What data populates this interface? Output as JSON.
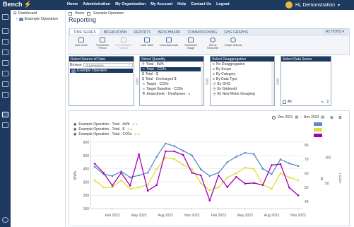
{
  "app": {
    "brand": "Bench",
    "user_greeting": "Hi, Demonstration"
  },
  "nav": [
    "Home",
    "Administration",
    "My Organisation",
    "My Account",
    "Help",
    "Contact Us",
    "Logout"
  ],
  "tree": {
    "root": "Dashboard",
    "child": "Example Operation"
  },
  "breadcrumbs": {
    "home": "Home",
    "current": "Example Operation"
  },
  "page_title": "Reporting",
  "tabs": [
    "TIME SERIES",
    "BREAKDOWN",
    "REPORTS",
    "BENCHMARK",
    "COMMISSIONING",
    "GHG GRAPHS"
  ],
  "actions_label": "ACTIONS",
  "tools": [
    {
      "label": "Add series",
      "icon": "add-series-icon",
      "enabled": true
    },
    {
      "label": "Timeseries Period",
      "icon": "calendar-icon",
      "enabled": true
    },
    {
      "label": "Normalisation Method",
      "icon": "normalise-icon",
      "enabled": false
    },
    {
      "label": "Data Table",
      "icon": "table-icon",
      "enabled": true
    },
    {
      "label": "Download Data",
      "icon": "download-icon",
      "enabled": true
    },
    {
      "label": "Download Image",
      "icon": "image-icon",
      "enabled": true
    },
    {
      "label": "Set as Favourite",
      "icon": "star-icon",
      "enabled": true
    },
    {
      "label": "Graph Options",
      "icon": "gear-icon",
      "enabled": true
    }
  ],
  "panels": {
    "source": {
      "header": "Select Source of Data",
      "browse_label": "Browse",
      "dropdown": "Organisation",
      "items": [
        "Example Operation"
      ],
      "selected": 0
    },
    "quantity": {
      "header": "Select Quantity",
      "items": [
        "Total - kWh",
        "Total - CO2e",
        "Total - $",
        "Total - Uncharged $",
        "Target - CO2e",
        "Target Baseline - CO2e",
        "Anaesthetic - Desflurane - L"
      ],
      "selected": 1
    },
    "disaggregation": {
      "header": "Select Deaggregation",
      "items": [
        "No Deaggregation",
        "By Scope",
        "By Category",
        "By Data Type",
        "By GHG",
        "By Gridmeld",
        "By New Meter Grouping"
      ],
      "selected": -1
    },
    "series": {
      "header": "Select Data Series",
      "all_label": "All"
    }
  },
  "chart_data": {
    "type": "line",
    "legend": [
      {
        "name": "Example Operation - Total - kWh",
        "color": "#5b8cc6"
      },
      {
        "name": "Example Operation - Total - $",
        "color": "#e0de3a"
      },
      {
        "name": "Example Operation - Total - CO2e",
        "color": "#a400b4"
      }
    ],
    "range": {
      "from": "Dec 2021",
      "to": "Nov 2023"
    },
    "x_ticks": [
      "Feb 2022",
      "May 2022",
      "Aug 2022",
      "Nov 2022",
      "Feb 2023",
      "May 2023",
      "Aug 2023",
      "Nov 2023"
    ],
    "x_tick_month_index": [
      2,
      5,
      8,
      11,
      14,
      17,
      20,
      23
    ],
    "left_axis": {
      "label": "MWh",
      "ticks": [
        "100",
        "200",
        "300",
        "400",
        "500",
        "600"
      ],
      "lim": [
        100,
        600
      ]
    },
    "right_axis_dollars": {
      "label": "k$",
      "ticks": [
        "40",
        "50",
        "60",
        "70",
        "80"
      ],
      "lim": [
        35,
        82
      ]
    },
    "right_axis_co2": {
      "label": "t CO2e",
      "ticks": [
        "50",
        "100"
      ],
      "lim": [
        0,
        130
      ]
    },
    "series": [
      {
        "name": "Example Operation - Total - kWh",
        "axis": "left",
        "color": "#5b8cc6",
        "values": [
          415,
          360,
          345,
          380,
          335,
          350,
          370,
          490,
          590,
          570,
          535,
          500,
          395,
          345,
          370,
          450,
          490,
          520,
          510,
          400,
          360,
          470,
          440,
          420
        ]
      },
      {
        "name": "Example Operation - Total - $",
        "axis": "right_dollars",
        "color": "#e0de3a",
        "values": [
          55,
          50,
          50,
          55,
          49,
          50,
          52,
          63,
          71,
          70,
          66,
          63,
          53,
          48,
          50,
          57,
          60,
          64,
          63,
          52,
          49,
          60,
          57,
          55
        ]
      },
      {
        "name": "Example Operation - Total - CO2e",
        "axis": "right_co2",
        "color": "#a400b4",
        "values": [
          88,
          70,
          45,
          70,
          45,
          106,
          35,
          46,
          112,
          112,
          105,
          70,
          65,
          16,
          65,
          42,
          62,
          49,
          50,
          46,
          85,
          87,
          41,
          26
        ]
      }
    ]
  }
}
